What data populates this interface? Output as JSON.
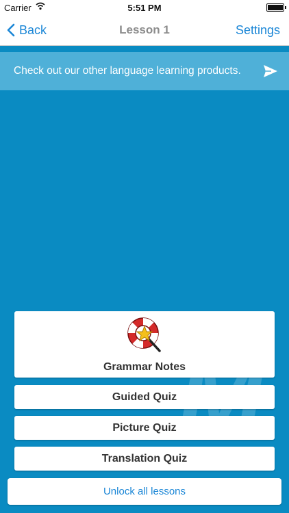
{
  "status": {
    "carrier": "Carrier",
    "time": "5:51 PM"
  },
  "nav": {
    "back_label": "Back",
    "title": "Lesson 1",
    "settings_label": "Settings"
  },
  "promo": {
    "text": "Check out our other language learning products."
  },
  "menu": {
    "grammar_notes": "Grammar Notes",
    "guided_quiz": "Guided Quiz",
    "picture_quiz": "Picture Quiz",
    "translation_quiz": "Translation Quiz",
    "unlock": "Unlock all lessons"
  },
  "icons": {
    "grammar": "lifebuoy-magic-wand-icon",
    "send": "paper-plane-icon",
    "back": "chevron-left-icon"
  },
  "colors": {
    "background": "#0a8bc2",
    "accent": "#1a86d6",
    "banner": "#4fb0d8"
  }
}
